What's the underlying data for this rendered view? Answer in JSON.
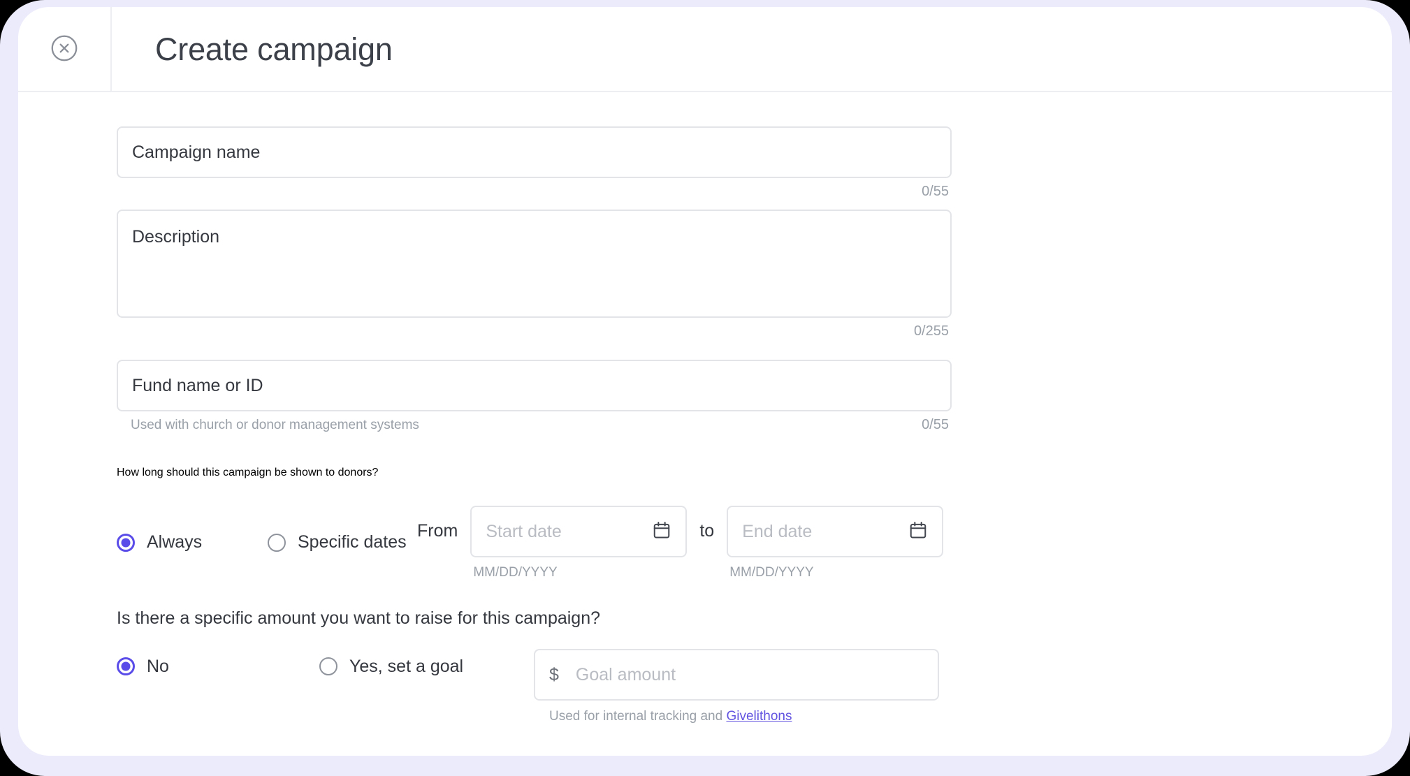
{
  "window": {
    "title": "Create campaign",
    "close_icon": "close-circle-icon"
  },
  "colors": {
    "page_background": "#000000",
    "frame": "#ecebfb",
    "card": "#ffffff",
    "accent": "#5a4ce8",
    "link": "#6254e0",
    "border": "#e2e4e8",
    "text": "#35383f",
    "muted": "#9aa0a8"
  },
  "form": {
    "campaign_name": {
      "placeholder": "Campaign name",
      "counter": "0/55"
    },
    "description": {
      "placeholder": "Description",
      "counter": "0/255"
    },
    "fund": {
      "placeholder": "Fund name or ID",
      "helper": "Used with church or donor management systems",
      "counter": "0/55"
    },
    "duration": {
      "question": "How long should this campaign be shown to donors?",
      "options": [
        {
          "label": "Always",
          "selected": true
        },
        {
          "label": "Specific dates",
          "selected": false
        }
      ],
      "from_label": "From",
      "to_label": "to",
      "start_date": {
        "placeholder": "Start date",
        "hint": "MM/DD/YYYY",
        "icon": "calendar-icon"
      },
      "end_date": {
        "placeholder": "End date",
        "hint": "MM/DD/YYYY",
        "icon": "calendar-icon"
      }
    },
    "goal": {
      "question": "Is there a specific amount you want to raise for this campaign?",
      "options": [
        {
          "label": "No",
          "selected": true
        },
        {
          "label": "Yes, set a goal",
          "selected": false
        }
      ],
      "currency_symbol": "$",
      "amount_placeholder": "Goal amount",
      "note_prefix": "Used for internal tracking and ",
      "note_link": "Givelithons"
    }
  }
}
